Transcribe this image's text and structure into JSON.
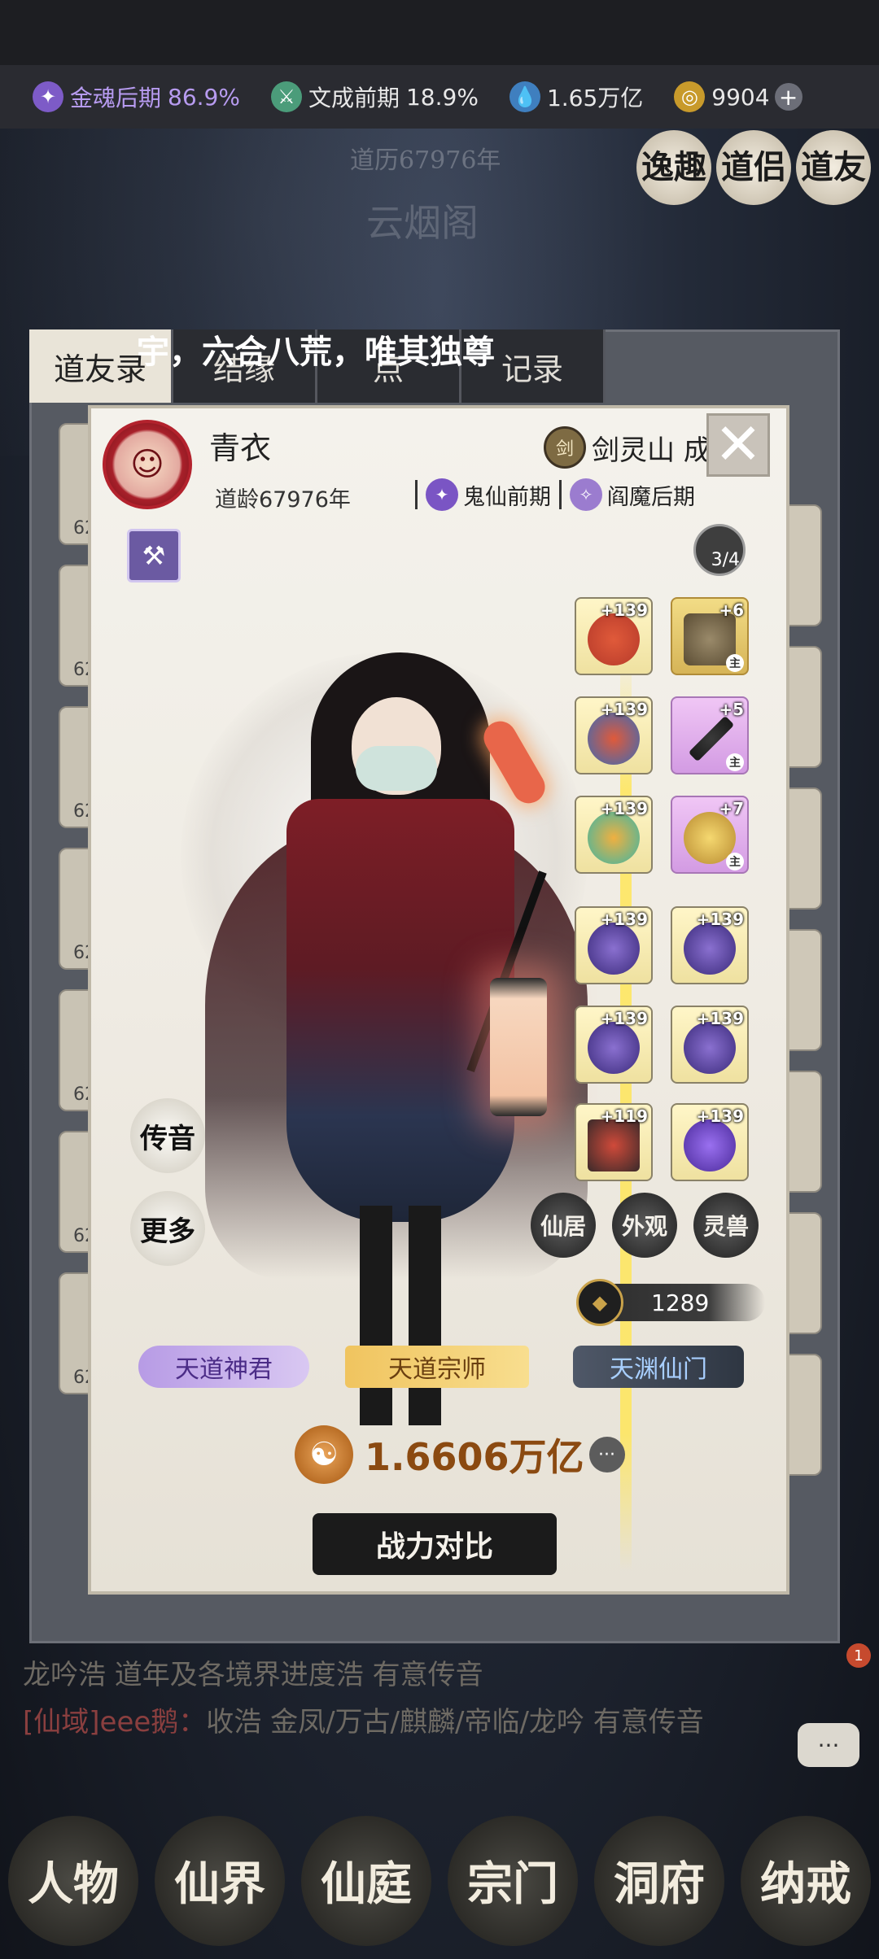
{
  "resources": [
    {
      "label": "金魂后期",
      "value": "86.9%",
      "icon": "soul-icon",
      "color": "#b79bf0"
    },
    {
      "label": "文成前期",
      "value": "18.9%",
      "icon": "sword-icon",
      "color": "#e8e8e8"
    },
    {
      "value": "1.65万亿",
      "icon": "spirit-drop-icon"
    },
    {
      "value": "9904",
      "icon": "coin-icon"
    }
  ],
  "top_buttons": [
    "逸趣",
    "道侣",
    "道友"
  ],
  "background": {
    "age_line": "道历67976年",
    "place": "云烟阁",
    "tabs": [
      "道友录",
      "结缘",
      "点",
      "记录"
    ],
    "left_cards": [
      "62",
      "62",
      "62",
      "62",
      "62",
      "62",
      "62"
    ]
  },
  "banner": "宇，六合八荒，唯其独尊",
  "profile": {
    "name": "青衣",
    "dao_age": "道龄67976年",
    "sect": "剑灵山  成员",
    "realm_1": "鬼仙前期",
    "realm_2": "阎魔后期",
    "slot_counter": "3/4"
  },
  "equipment": {
    "left": [
      "+139",
      "+139",
      "+139",
      "+139",
      "+139",
      "+119"
    ],
    "right": [
      "+6",
      "+5",
      "+7",
      "+139",
      "+139",
      "+139"
    ],
    "main_tag": "主"
  },
  "side_buttons": {
    "chuanyin": "传音",
    "gengduo": "更多",
    "xianju": "仙居",
    "waiguan": "外观",
    "lingshou": "灵兽"
  },
  "pet_power": "1289",
  "titles": [
    "天道神君",
    "天道宗师",
    "天渊仙门"
  ],
  "total_power": "1.6606万亿",
  "compare_button": "战力对比",
  "chat": {
    "line1": "龙吟浩 道年及各境界进度浩 有意传音",
    "tag": "[仙域]",
    "line2_name": "eee鹅：",
    "line2_text": "收浩 金凤/万古/麒麟/帝临/龙吟 有意传音",
    "badge": "1"
  },
  "bottom_nav": [
    "人物",
    "仙界",
    "仙庭",
    "宗门",
    "洞府",
    "纳戒"
  ]
}
